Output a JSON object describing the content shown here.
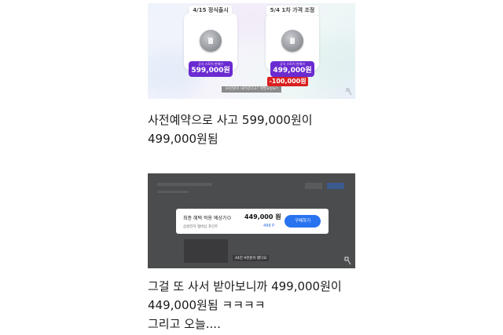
{
  "promo": {
    "left_tag": "4/15 정식출시",
    "right_tag": "5/4 1차 가격 조정",
    "left_sub": "공식 스토어 판매가",
    "left_price": "599,000원",
    "right_sub": "공식 스토어 판매가",
    "right_price": "499,000원",
    "discount": "-100,000원",
    "footnote": "10만원이 내려갔다고? 제발요잉요?",
    "accent_color": "#6a2bd1",
    "discount_color": "#d9201f"
  },
  "caption1": {
    "line1": "사전예약으로 사고 599,000원이",
    "line2": "499,000원됨"
  },
  "shot": {
    "label": "최종 혜택 적용 예상가",
    "info_icon": "info-icon",
    "sub": "삼성전자 멤버십 포인트",
    "price": "449,000 원",
    "points": "499 P",
    "button": "구매하기",
    "tag": "44만 9천원이 됐다요",
    "button_color": "#2873f0"
  },
  "caption2": {
    "line1": "그걸 또 사서 받아보니까 499,000원이",
    "line2": "449,000원됨 ㅋㅋㅋㅋ",
    "line3": "그리고 오늘...."
  }
}
